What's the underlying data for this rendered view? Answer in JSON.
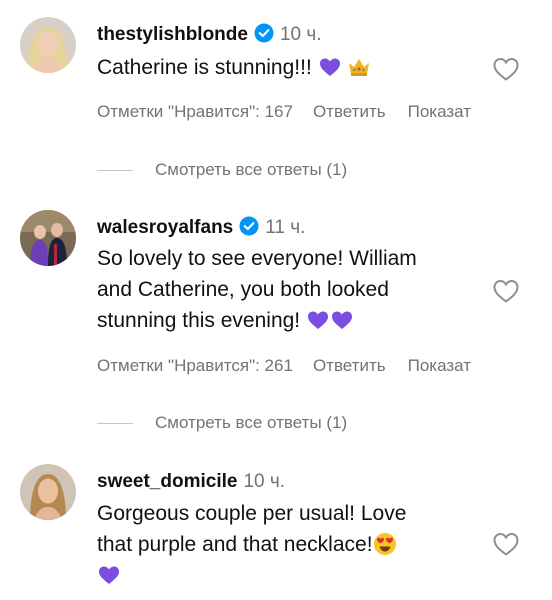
{
  "comments": [
    {
      "username": "thestylishblonde",
      "time": "10 ч.",
      "text": "Catherine is stunning!!!",
      "likes": "Отметки \"Нравится\": 167",
      "reply": "Ответить",
      "show": "Показат",
      "view_replies": "Смотреть все ответы (1)"
    },
    {
      "username": "walesroyalfans",
      "time": "11 ч.",
      "text_lines": [
        "So lovely to see everyone! William",
        "and Catherine, you both looked",
        "stunning this evening!"
      ],
      "likes": "Отметки \"Нравится\": 261",
      "reply": "Ответить",
      "show": "Показат",
      "view_replies": "Смотреть все ответы (1)"
    },
    {
      "username": "sweet_domicile",
      "time": "10 ч.",
      "text_lines": [
        "Gorgeous couple per usual! Love",
        "that purple and that necklace!"
      ]
    }
  ],
  "colors": {
    "text": "#111111",
    "muted": "#737373",
    "verified": "#0095f6",
    "heart_purple": "#7b4de0"
  },
  "icons": [
    "verified-badge-icon",
    "heart-outline-icon",
    "purple-heart-emoji",
    "crown-emoji",
    "heart-eyes-emoji"
  ]
}
